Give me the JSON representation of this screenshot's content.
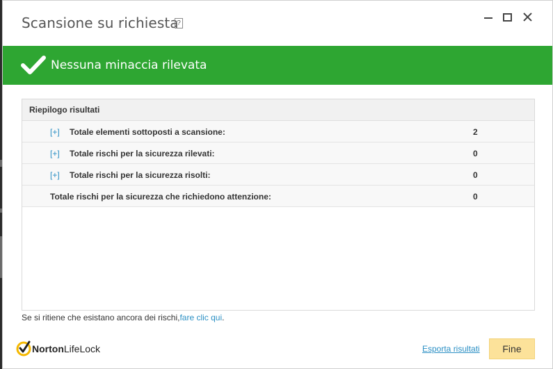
{
  "window": {
    "title": "Scansione su richiesta",
    "help_label": "?"
  },
  "icons": {
    "minimize": "minimize-icon",
    "maximize": "maximize-icon",
    "close": "close-icon",
    "check": "checkmark-icon",
    "logo": "norton-check-icon"
  },
  "banner": {
    "message": "Nessuna minaccia rilevata",
    "color": "#2ea632"
  },
  "summary": {
    "header": "Riepilogo risultati",
    "expand_label": "[+]",
    "rows": [
      {
        "label": "Totale elementi sottoposti a scansione:",
        "value": "2"
      },
      {
        "label": "Totale rischi per la sicurezza rilevati:",
        "value": "0"
      },
      {
        "label": "Totale rischi per la sicurezza risolti:",
        "value": "0"
      },
      {
        "label": "Totale rischi per la sicurezza che richiedono attenzione:",
        "value": "0"
      }
    ]
  },
  "footer": {
    "note_text": "Se si ritiene che esistano ancora dei rischi,",
    "note_link": "fare clic qui",
    "note_end": ".",
    "brand_bold": "Norton",
    "brand_light": "LifeLock",
    "export_label": "Esporta risultati",
    "done_label": "Fine"
  },
  "colors": {
    "link": "#2a8fc4",
    "done_button": "#fce29a"
  }
}
